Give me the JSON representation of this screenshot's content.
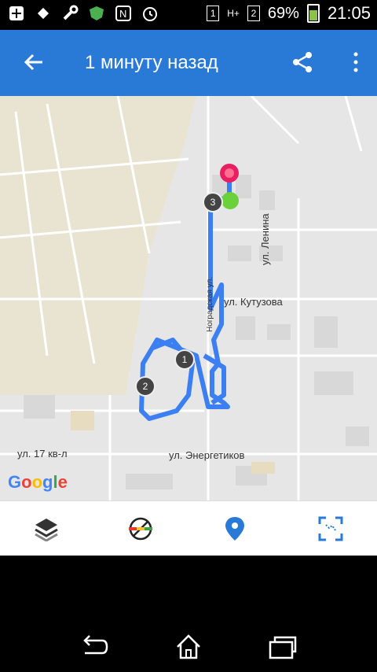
{
  "status_bar": {
    "battery_percent": "69%",
    "time": "21:05",
    "sim1": "1",
    "sim2": "2",
    "network": "H+"
  },
  "app_bar": {
    "title": "1 минуту назад",
    "back_icon": "arrow-back-icon",
    "share_icon": "share-icon",
    "more_icon": "more-vert-icon"
  },
  "map": {
    "streets": [
      {
        "name": "ул. Кутузова"
      },
      {
        "name": "ул. Ленина"
      },
      {
        "name": "ул. 17 кв-л"
      },
      {
        "name": "ул. Энергетиков"
      },
      {
        "name": "Ноградская ул."
      }
    ],
    "markers": [
      "1",
      "2",
      "3"
    ],
    "google_logo": "Google"
  },
  "bottom_bar": {
    "buttons": [
      "layers-icon",
      "no-tracking-icon",
      "location-pin-icon",
      "fit-bounds-icon"
    ]
  },
  "colors": {
    "app_bar": "#2979d6",
    "route": "#3b7ff2",
    "start_marker": "#e91e63",
    "end_marker": "#6ad13b"
  }
}
